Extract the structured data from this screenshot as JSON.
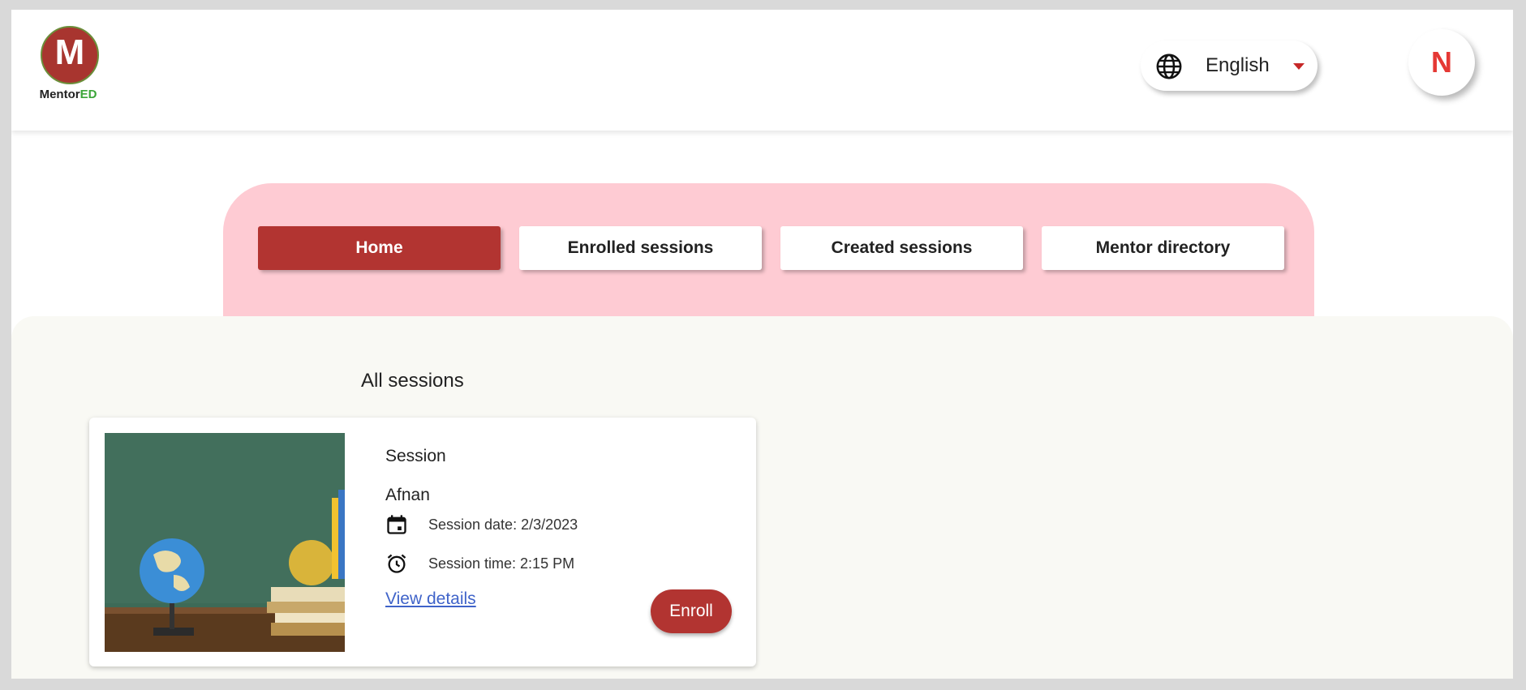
{
  "brand": {
    "logo_letter": "M",
    "name_part1": "Mentor",
    "name_part2": "ED"
  },
  "header": {
    "language": {
      "selected": "English",
      "icon": "globe-icon"
    },
    "profile": {
      "initial": "N"
    }
  },
  "nav": {
    "tabs": [
      {
        "label": "Home",
        "active": true
      },
      {
        "label": "Enrolled sessions",
        "active": false
      },
      {
        "label": "Created sessions",
        "active": false
      },
      {
        "label": "Mentor directory",
        "active": false
      }
    ]
  },
  "main": {
    "section_title": "All sessions",
    "sessions": [
      {
        "title": "Session",
        "mentor": "Afnan",
        "date_label": "Session date: 2/3/2023",
        "time_label": "Session time: 2:15 PM",
        "details_link": "View details",
        "action": "Enroll"
      }
    ]
  },
  "colors": {
    "accent": "#b23431",
    "nav_bg": "#fecbd3",
    "content_bg": "#f9f9f4",
    "link": "#3f63c9",
    "avatar_text": "#e53935"
  }
}
